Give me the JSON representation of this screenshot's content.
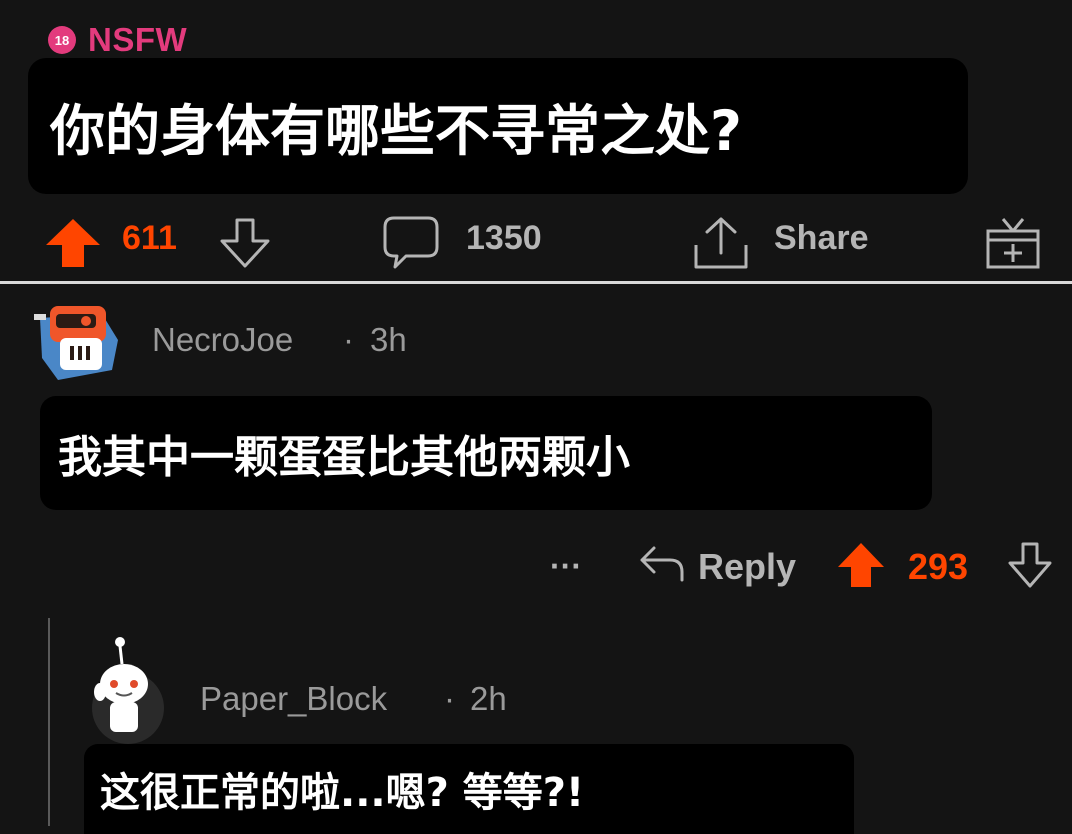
{
  "post": {
    "nsfw_badge": "18",
    "nsfw_label": "NSFW",
    "title": "你的身体有哪些不寻常之处?",
    "upvotes": "611",
    "comments": "1350",
    "share_label": "Share"
  },
  "comment1": {
    "username": "NecroJoe",
    "separator": "·",
    "time": "3h",
    "text": "我其中一颗蛋蛋比其他两颗小",
    "more": "···",
    "reply_label": "Reply",
    "upvotes": "293"
  },
  "comment2": {
    "username": "Paper_Block",
    "separator": "·",
    "time": "2h",
    "text": "这很正常的啦...嗯? 等等?!"
  },
  "colors": {
    "upvote": "#ff4500",
    "nsfw": "#e33b7d",
    "background": "#141414",
    "text_muted": "#9a9a9a"
  },
  "icons": [
    "upvote-icon",
    "downvote-icon",
    "comment-icon",
    "share-icon",
    "award-icon",
    "reply-icon",
    "more-icon"
  ]
}
